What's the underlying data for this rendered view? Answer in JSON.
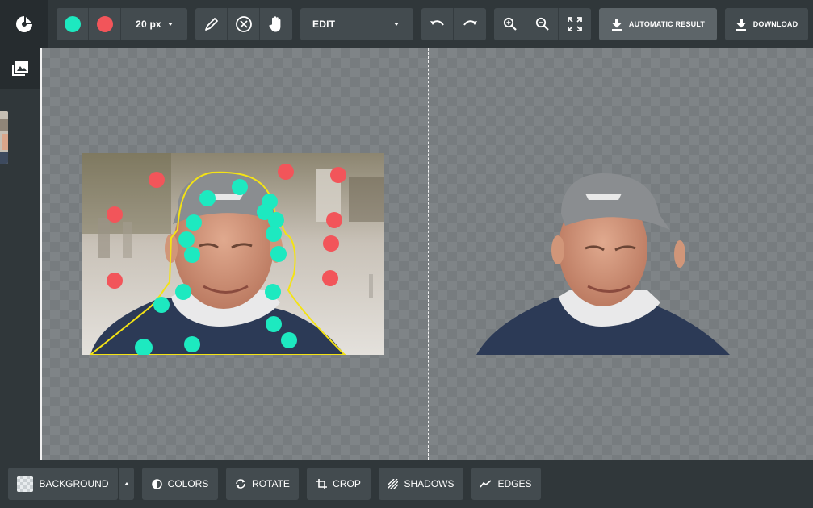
{
  "toolbar": {
    "brush_size": "20 px",
    "mode": "EDIT",
    "automatic_result": "AUTOMATIC RESULT",
    "download": "DOWNLOAD"
  },
  "colors": {
    "keep_marker": "#1de9c0",
    "remove_marker": "#f2555a",
    "outline": "#f4e314"
  },
  "icons": [
    "logo-icon",
    "keep-brush-icon",
    "remove-brush-icon",
    "pencil-icon",
    "erase-marker-icon",
    "hand-pan-icon",
    "undo-icon",
    "redo-icon",
    "zoom-in-icon",
    "zoom-out-icon",
    "fit-screen-icon",
    "download-icon",
    "image-gallery-icon",
    "colors-icon",
    "rotate-icon",
    "crop-icon",
    "shadows-icon",
    "edges-icon"
  ],
  "bottom": {
    "background": "BACKGROUND",
    "colors": "COLORS",
    "rotate": "ROTATE",
    "crop": "CROP",
    "shadows": "SHADOWS",
    "edges": "EDGES"
  }
}
